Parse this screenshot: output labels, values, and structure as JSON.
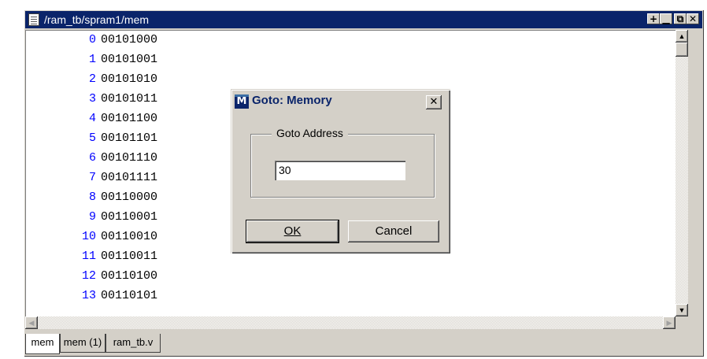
{
  "window": {
    "title": "/ram_tb/spram1/mem"
  },
  "memory": {
    "rows": [
      {
        "address": "0",
        "value": "00101000"
      },
      {
        "address": "1",
        "value": "00101001"
      },
      {
        "address": "2",
        "value": "00101010"
      },
      {
        "address": "3",
        "value": "00101011"
      },
      {
        "address": "4",
        "value": "00101100"
      },
      {
        "address": "5",
        "value": "00101101"
      },
      {
        "address": "6",
        "value": "00101110"
      },
      {
        "address": "7",
        "value": "00101111"
      },
      {
        "address": "8",
        "value": "00110000"
      },
      {
        "address": "9",
        "value": "00110001"
      },
      {
        "address": "10",
        "value": "00110010"
      },
      {
        "address": "11",
        "value": "00110011"
      },
      {
        "address": "12",
        "value": "00110100"
      },
      {
        "address": "13",
        "value": "00110101"
      }
    ]
  },
  "tabs": [
    {
      "label": "mem"
    },
    {
      "label": "mem (1)"
    },
    {
      "label": "ram_tb.v"
    }
  ],
  "dialog": {
    "title": "Goto: Memory",
    "icon_letter": "M",
    "group_label": "Goto Address",
    "address_value": "30",
    "ok_label": "OK",
    "cancel_label": "Cancel"
  },
  "colors": {
    "titlebar": "#0a246a",
    "address_text": "#0000ff",
    "face": "#d4d0c8"
  }
}
